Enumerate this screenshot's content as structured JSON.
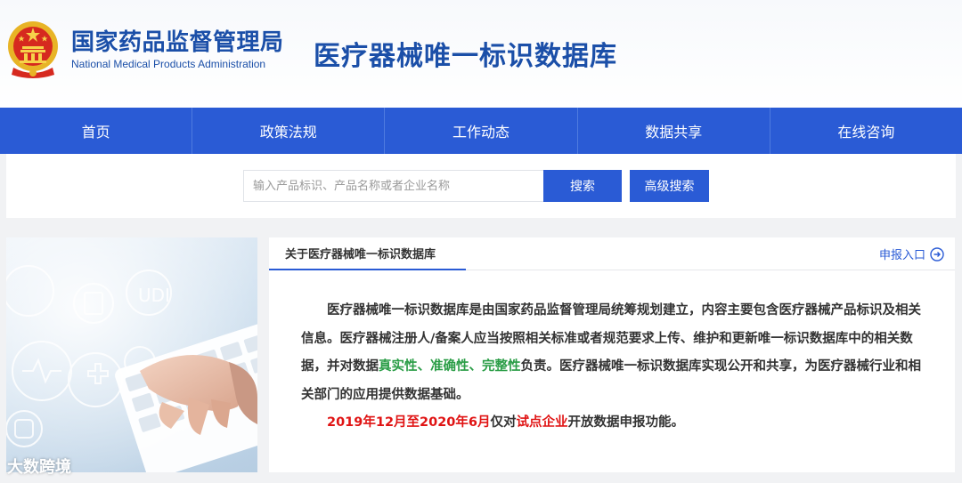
{
  "header": {
    "agency_cn": "国家药品监督管理局",
    "agency_en": "National Medical Products  Administration",
    "site_title": "医疗器械唯一标识数据库"
  },
  "nav": {
    "items": [
      {
        "label": "首页"
      },
      {
        "label": "政策法规"
      },
      {
        "label": "工作动态"
      },
      {
        "label": "数据共享"
      },
      {
        "label": "在线咨询"
      }
    ]
  },
  "search": {
    "placeholder": "输入产品标识、产品名称或者企业名称",
    "value": "",
    "search_label": "搜索",
    "advanced_label": "高级搜索"
  },
  "hero": {
    "udi_text": "UDI"
  },
  "about": {
    "tab_label": "关于医疗器械唯一标识数据库",
    "apply_label": "申报入口",
    "para_part1": "医疗器械唯一标识数据库是由国家药品监督管理局统筹规划建立，内容主要包含医疗器械产品标识及相关信息。医疗器械注册人/备案人应当按照相关标准或者规范要求上传、维护和更新唯一标识数据库中的相关数据，并对数据",
    "highlight_1": "真实性",
    "sep_1": "、",
    "highlight_2": "准确性",
    "sep_2": "、",
    "highlight_3": "完整性",
    "para_part2": "负责。医疗器械唯一标识数据库实现公开和共享，为医疗器械行业和相关部门的应用提供数据基础。",
    "note_date": "2019年12月至2020年6月",
    "note_mid": "仅对",
    "note_pilot": "试点企业",
    "note_end": "开放数据申报功能。"
  },
  "watermark": "大数跨境",
  "colors": {
    "brand_blue": "#1b4fa8",
    "nav_blue": "#2a5bd5",
    "highlight_green": "#2a9d46",
    "highlight_red": "#e01414"
  },
  "icons": {
    "emblem": "national-emblem-icon",
    "apply": "arrow-circle-right-icon"
  }
}
